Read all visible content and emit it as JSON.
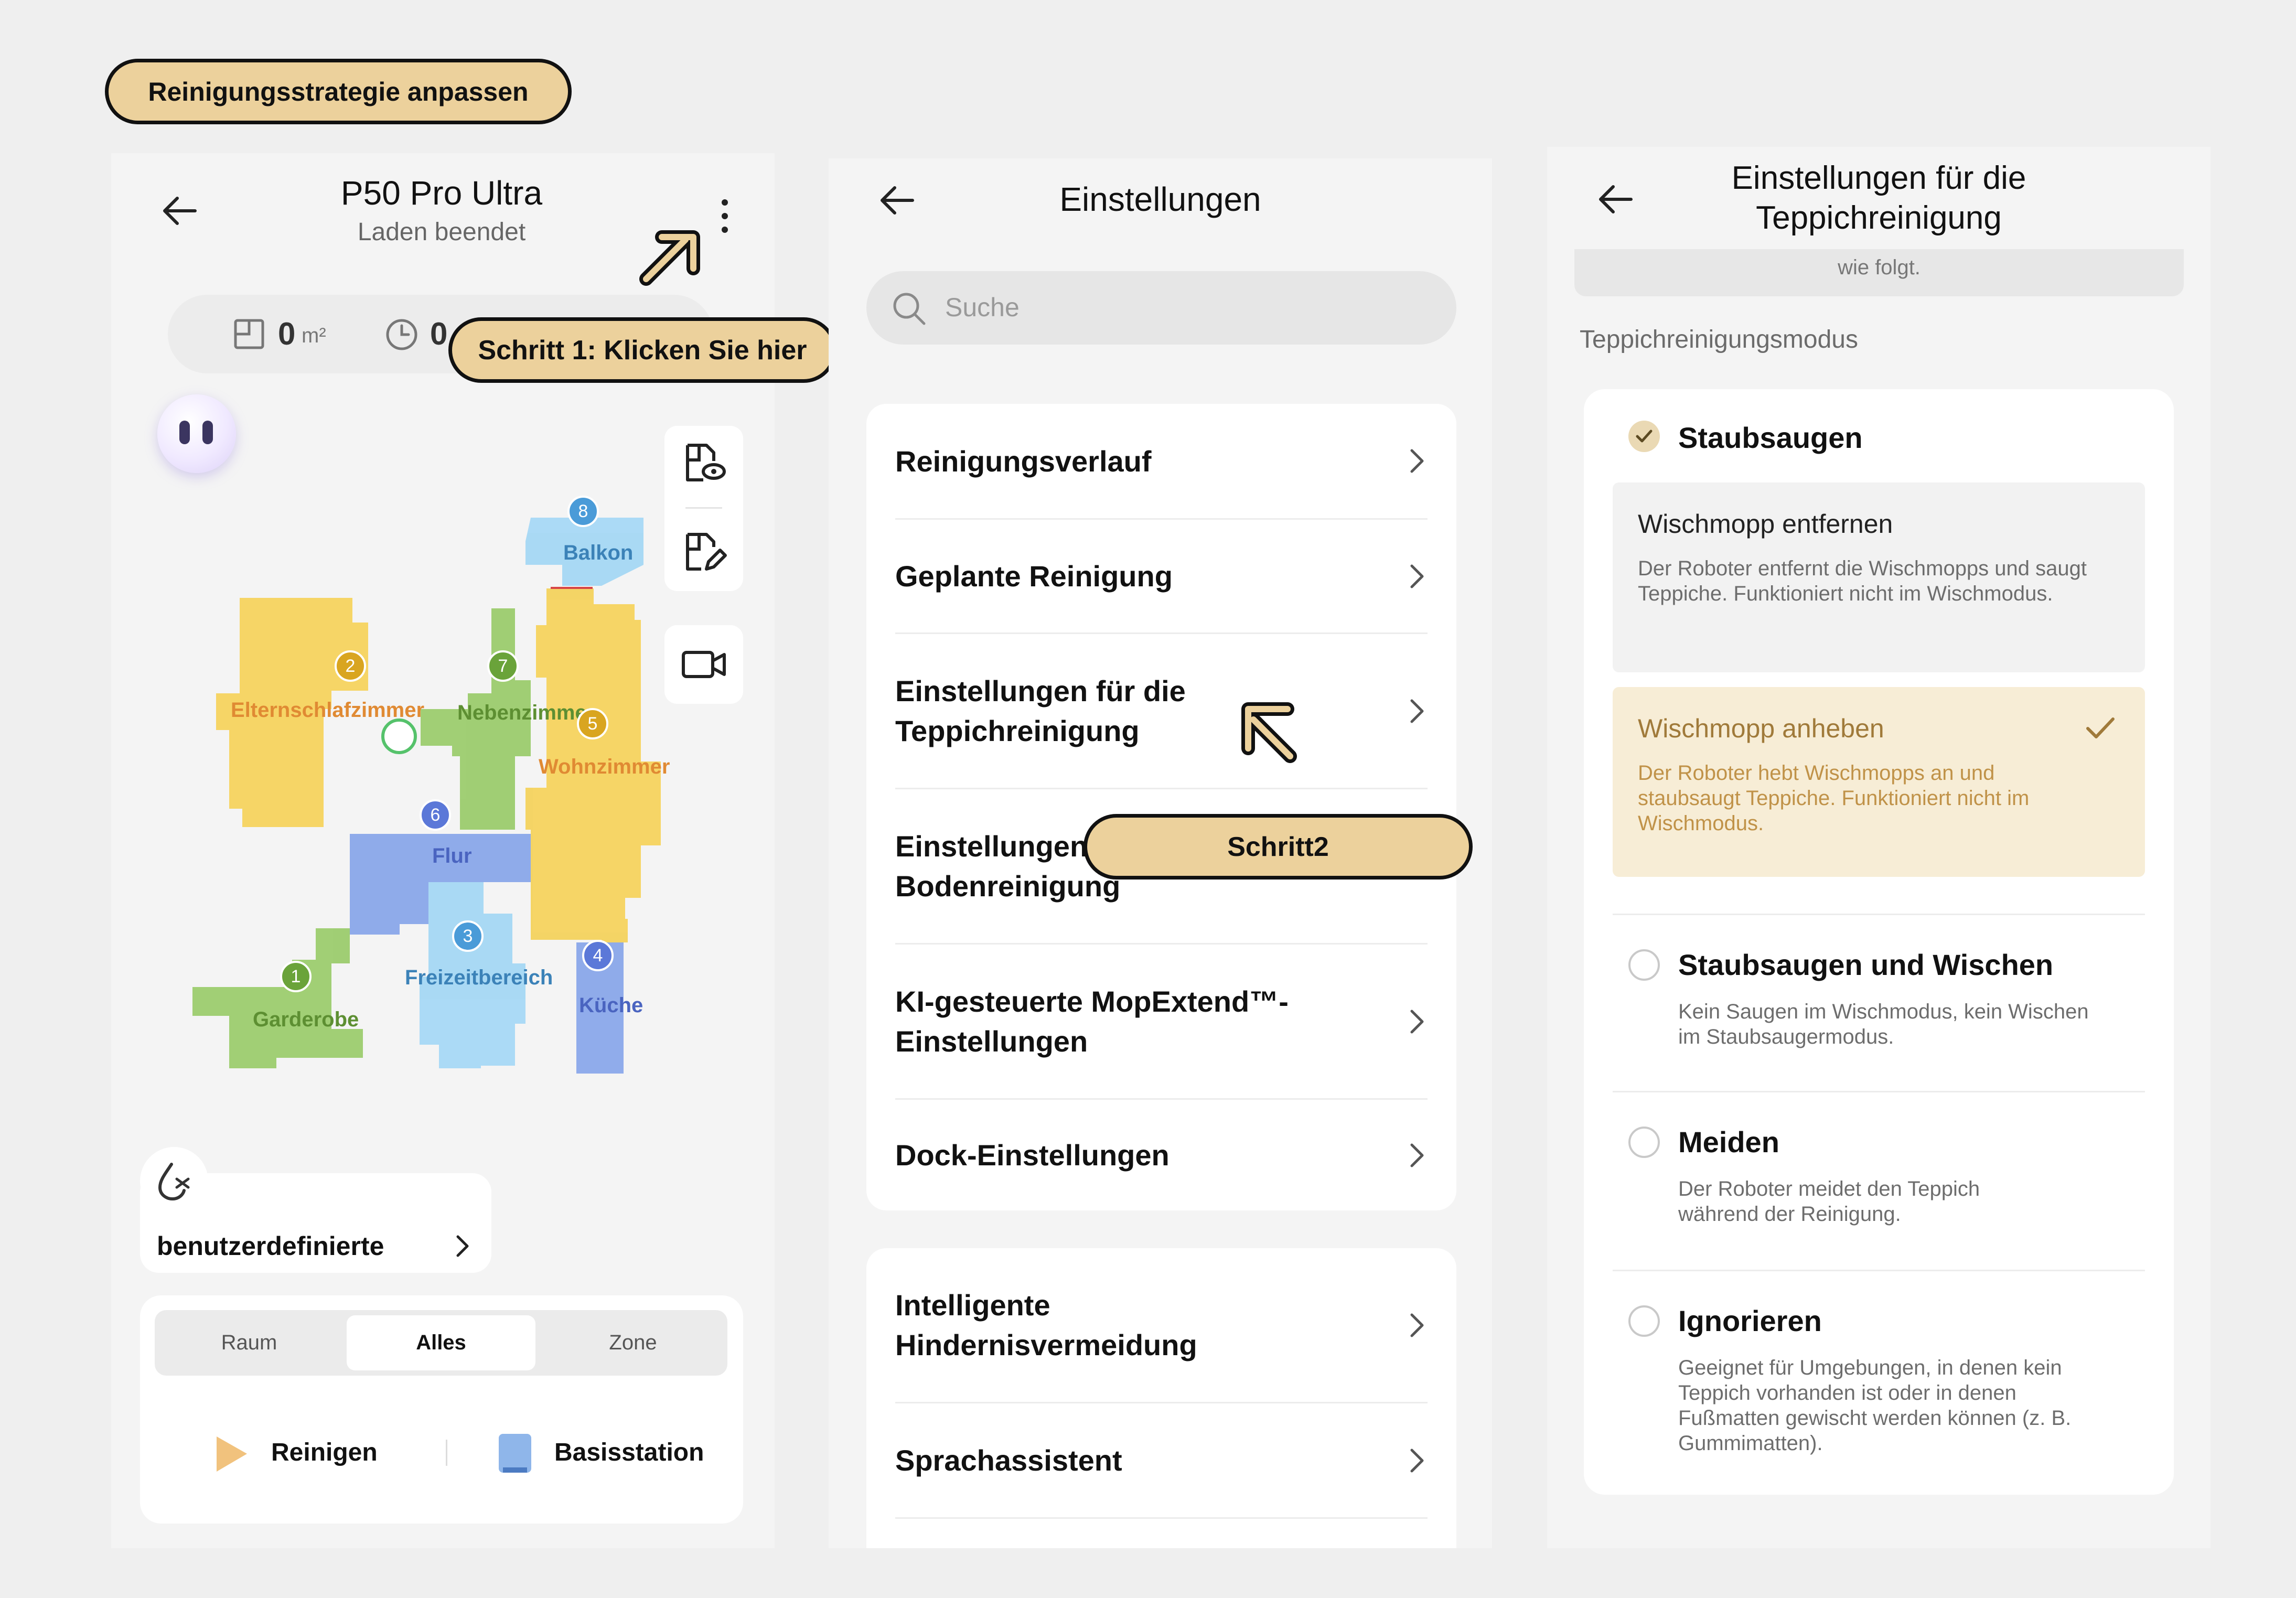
{
  "header": {
    "title": "Reinigungsstrategie anpassen"
  },
  "callouts": {
    "step1": "Schritt 1: Klicken Sie hier",
    "step2": "Schritt2"
  },
  "screen1": {
    "device_title": "P50 Pro Ultra",
    "device_status": "Laden beendet",
    "stats": {
      "area_value": "0",
      "area_unit": "m²",
      "time_value": "0"
    },
    "rooms": [
      {
        "num": "8",
        "name": "Balkon"
      },
      {
        "num": "2",
        "name": "Elternschlafzimmer"
      },
      {
        "num": "7",
        "name": "Nebenzimmer"
      },
      {
        "num": "5",
        "name": "Wohnzimmer"
      },
      {
        "num": "6",
        "name": "Flur"
      },
      {
        "num": "3",
        "name": "Freizeitbereich"
      },
      {
        "num": "4",
        "name": "Küche"
      },
      {
        "num": "1",
        "name": "Garderobe"
      }
    ],
    "mode_label": "benutzerdefinierte",
    "tabs": [
      "Raum",
      "Alles",
      "Zone"
    ],
    "active_tab": "Alles",
    "actions": {
      "clean": "Reinigen",
      "dock": "Basisstation"
    }
  },
  "screen2": {
    "title": "Einstellungen",
    "search_placeholder": "Suche",
    "group1": [
      "Reinigungsverlauf",
      "Geplante Reinigung",
      "Einstellungen für die Teppichreinigung",
      "Einstellungen für die Bodenreinigung",
      "KI-gesteuerte MopExtend™-Einstellungen",
      "Dock-Einstellungen"
    ],
    "group1_visible": {
      "row4a": "Einstellungen",
      "row4b": "Bodenreinigung"
    },
    "group2": [
      "Intelligente Hindernisvermeidung",
      "Sprachassistent"
    ]
  },
  "screen3": {
    "title_line1": "Einstellungen für die",
    "title_line2": "Teppichreinigung",
    "top_snippet": "wie folgt.",
    "section_label": "Teppichreinigungsmodus",
    "options": [
      {
        "title": "Staubsaugen",
        "selected": true,
        "suboptions": [
          {
            "title": "Wischmopp entfernen",
            "desc": "Der Roboter entfernt die Wischmopps und saugt Teppiche. Funktioniert nicht im Wischmodus.",
            "selected": false
          },
          {
            "title": "Wischmopp anheben",
            "desc": "Der Roboter hebt Wischmopps an und staubsaugt Teppiche. Funktioniert nicht im Wischmodus.",
            "selected": true
          }
        ]
      },
      {
        "title": "Staubsaugen und Wischen",
        "desc": "Kein Saugen im Wischmodus, kein Wischen im Staubsaugermodus.",
        "selected": false
      },
      {
        "title": "Meiden",
        "desc": "Der Roboter meidet den Teppich während der Reinigung.",
        "selected": false
      },
      {
        "title": "Ignorieren",
        "desc": "Geeignet für Umgebungen, in denen kein Teppich vorhanden ist oder in denen Fußmatten gewischt werden können (z. B. Gummimatten).",
        "selected": false
      }
    ]
  },
  "colors": {
    "callout_fill": "#ecd19c",
    "selected_fill": "#f7edd6",
    "selected_text": "#a07a3a",
    "room_yellow": "#f5d35e",
    "room_green": "#9ccc6e",
    "room_blue": "#8aa8ea",
    "room_lightblue": "#a6d8f5"
  }
}
